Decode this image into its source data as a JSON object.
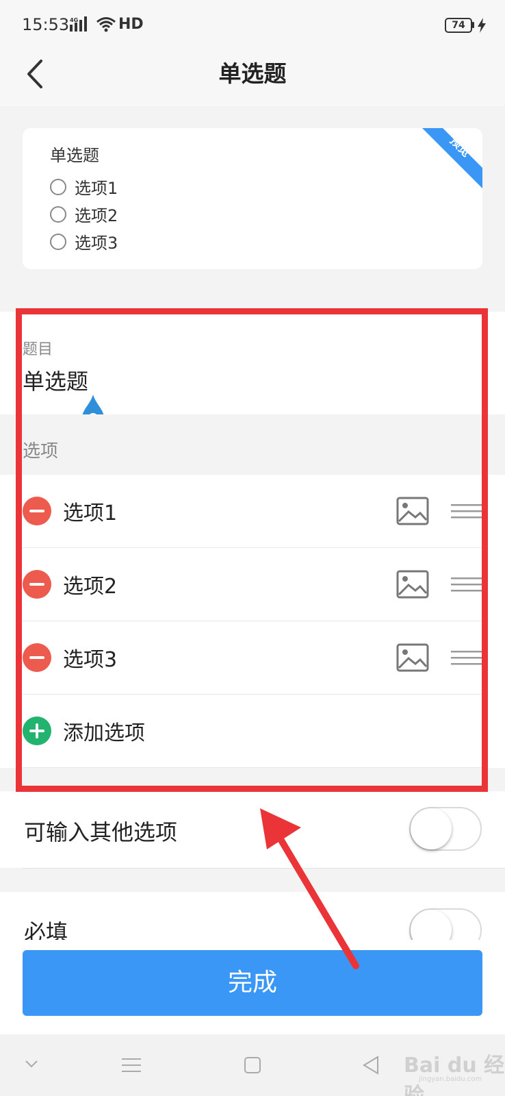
{
  "status_bar": {
    "time": "15:53",
    "network": "4G",
    "wifi_label": "HD",
    "battery": "74"
  },
  "header": {
    "title": "单选题",
    "back_icon": "chevron-left-icon"
  },
  "preview": {
    "badge": "预览",
    "question": "单选题",
    "options": [
      "选项1",
      "选项2",
      "选项3"
    ]
  },
  "question": {
    "label": "题目",
    "value": "单选题"
  },
  "options_section": {
    "label": "选项",
    "options": [
      {
        "label": "选项1"
      },
      {
        "label": "选项2"
      },
      {
        "label": "选项3"
      }
    ],
    "add_label": "添加选项"
  },
  "settings": [
    {
      "label": "可输入其他选项",
      "enabled": false
    },
    {
      "label": "必填",
      "enabled": false
    }
  ],
  "done_button": "完成",
  "watermark": {
    "text": "Bai du 经验",
    "sub": "jingyan.baidu.com"
  },
  "colors": {
    "primary": "#3a97f5",
    "remove": "#ec5b4e",
    "add": "#22b36e",
    "annotation": "#ea3437"
  }
}
